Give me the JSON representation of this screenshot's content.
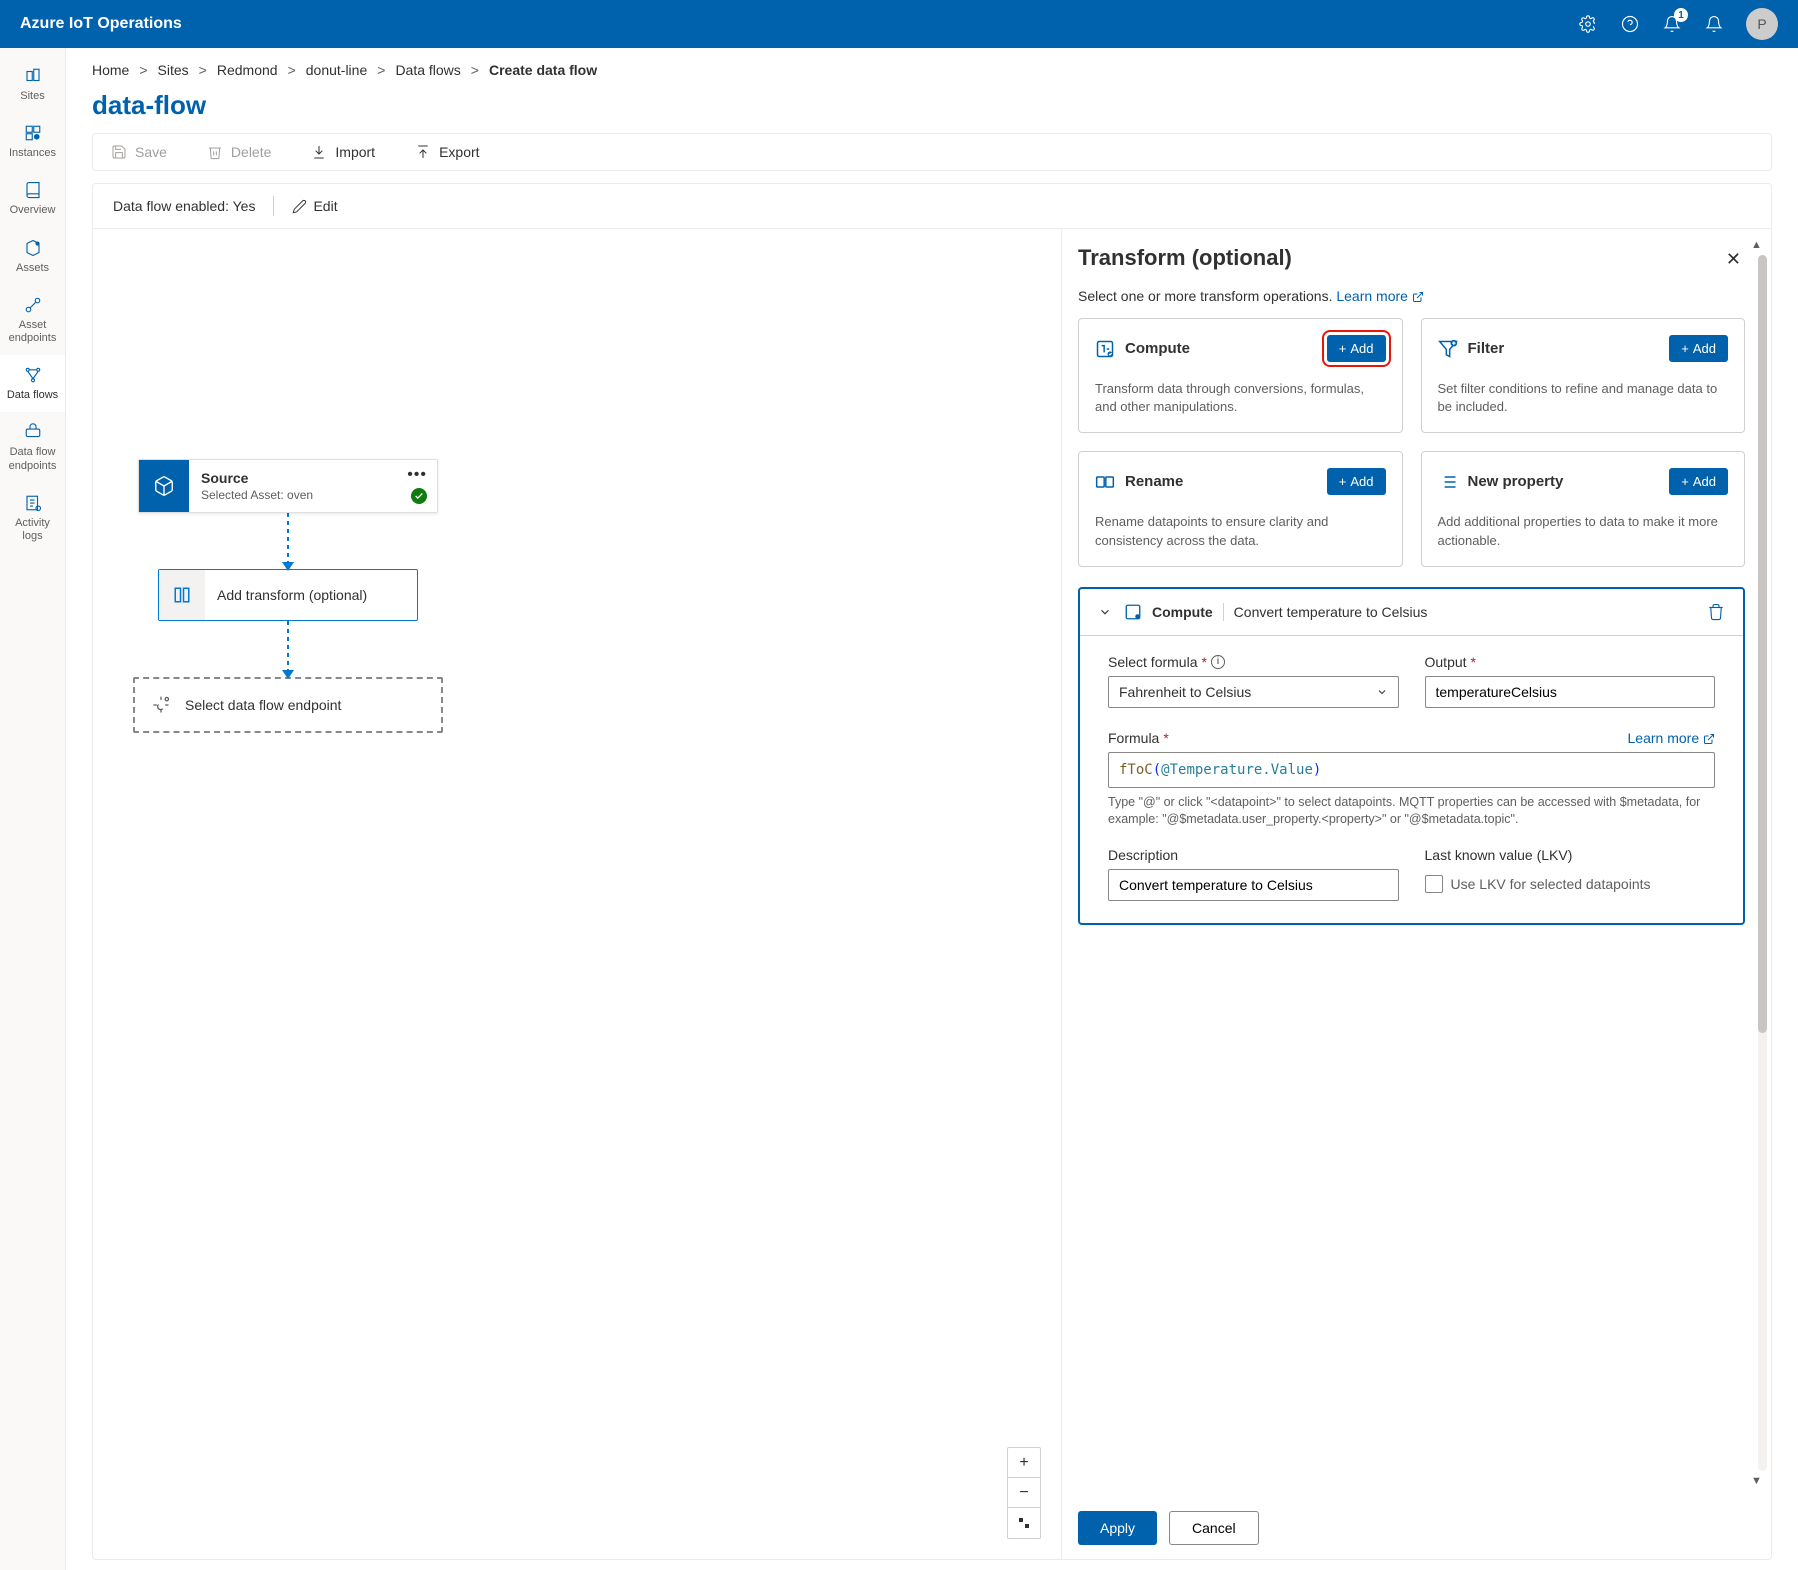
{
  "header": {
    "title": "Azure IoT Operations",
    "notification_count": "1",
    "avatar_initial": "P"
  },
  "sidebar": {
    "items": [
      {
        "label": "Sites"
      },
      {
        "label": "Instances"
      },
      {
        "label": "Overview"
      },
      {
        "label": "Assets"
      },
      {
        "label": "Asset endpoints"
      },
      {
        "label": "Data flows"
      },
      {
        "label": "Data flow endpoints"
      },
      {
        "label": "Activity logs"
      }
    ]
  },
  "breadcrumb": {
    "items": [
      "Home",
      "Sites",
      "Redmond",
      "donut-line",
      "Data flows",
      "Create data flow"
    ]
  },
  "page_title": "data-flow",
  "toolbar": {
    "save_label": "Save",
    "delete_label": "Delete",
    "import_label": "Import",
    "export_label": "Export"
  },
  "status": {
    "label": "Data flow enabled: Yes",
    "edit_label": "Edit"
  },
  "flow": {
    "source": {
      "title": "Source",
      "subtitle": "Selected Asset: oven"
    },
    "transform": {
      "label": "Add transform (optional)"
    },
    "endpoint": {
      "label": "Select data flow endpoint"
    }
  },
  "panel": {
    "title": "Transform (optional)",
    "description": "Select one or more transform operations. ",
    "learn_more": "Learn more",
    "ops": {
      "compute": {
        "name": "Compute",
        "desc": "Transform data through conversions, formulas, and other manipulations.",
        "add": "Add"
      },
      "filter": {
        "name": "Filter",
        "desc": "Set filter conditions to refine and manage data to be included.",
        "add": "Add"
      },
      "rename": {
        "name": "Rename",
        "desc": "Rename datapoints to ensure clarity and consistency across the data.",
        "add": "Add"
      },
      "newprop": {
        "name": "New property",
        "desc": "Add additional properties to data to make it more actionable.",
        "add": "Add"
      }
    },
    "compute_section": {
      "head_name": "Compute",
      "head_desc": "Convert temperature to Celsius",
      "formula_label": "Select formula",
      "formula_value": "Fahrenheit to Celsius",
      "output_label": "Output",
      "output_value": "temperatureCelsius",
      "formula_code_label": "Formula",
      "formula_learn_more": "Learn more",
      "formula_fn": "fToC",
      "formula_param": "@Temperature.Value",
      "formula_hint": "Type \"@\" or click \"<datapoint>\" to select datapoints. MQTT properties can be accessed with $metadata, for example: \"@$metadata.user_property.<property>\" or \"@$metadata.topic\".",
      "description_label": "Description",
      "description_value": "Convert temperature to Celsius",
      "lkv_label": "Last known value (LKV)",
      "lkv_checkbox_label": "Use LKV for selected datapoints"
    },
    "footer": {
      "apply": "Apply",
      "cancel": "Cancel"
    }
  }
}
